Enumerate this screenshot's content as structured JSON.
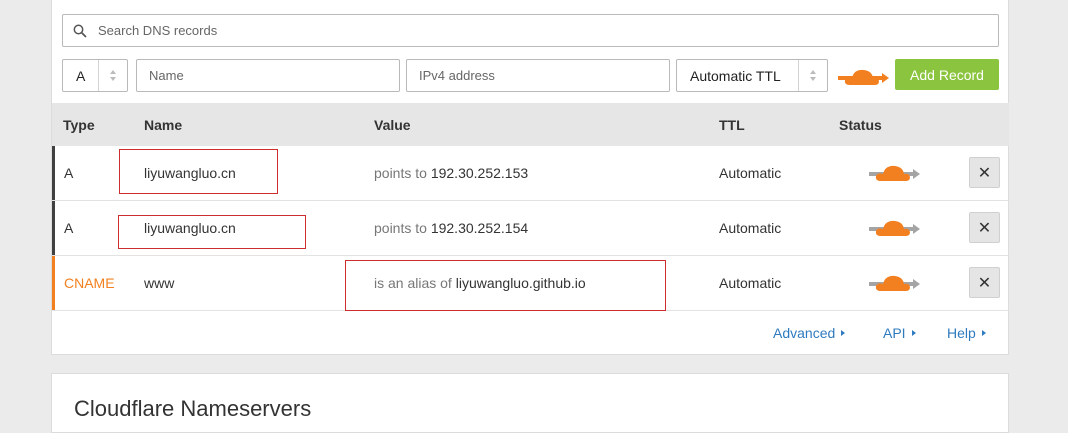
{
  "search": {
    "placeholder": "Search DNS records"
  },
  "form": {
    "type_value": "A",
    "name_placeholder": "Name",
    "ip_placeholder": "IPv4 address",
    "ttl_value": "Automatic TTL",
    "add_button": "Add Record"
  },
  "table": {
    "columns": [
      "Type",
      "Name",
      "Value",
      "TTL",
      "Status"
    ],
    "rows": [
      {
        "type": "A",
        "name": "liyuwangluo.cn",
        "value_prefix": "points to",
        "value": "192.30.252.153",
        "ttl": "Automatic"
      },
      {
        "type": "A",
        "name": "liyuwangluo.cn",
        "value_prefix": "points to",
        "value": "192.30.252.154",
        "ttl": "Automatic"
      },
      {
        "type": "CNAME",
        "name": "www",
        "value_prefix": "is an alias of",
        "value": "liyuwangluo.github.io",
        "ttl": "Automatic"
      }
    ],
    "delete_label": "✕"
  },
  "links": {
    "advanced": "Advanced",
    "api": "API",
    "help": "Help"
  },
  "nameservers": {
    "title": "Cloudflare Nameservers"
  },
  "colors": {
    "accent_orange": "#f38020",
    "add_green": "#8bc53f",
    "link_blue": "#2f7bbf",
    "annotation_red": "#cc2d2d"
  }
}
